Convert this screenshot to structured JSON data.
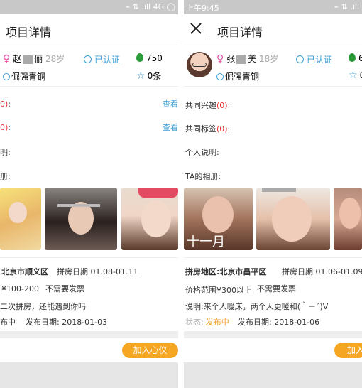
{
  "left": {
    "status": {
      "time": "",
      "indicators": "⌁ ⇅ .ıll 4G ◯"
    },
    "title": "项目详情",
    "name": "赵",
    "name2": "俪",
    "age": "28岁",
    "verified": "已认证",
    "points": "750",
    "medal": "倔强青铜",
    "stars": "0条",
    "rows": [
      {
        "label": "0)",
        "suffix": ":",
        "link": "查看"
      },
      {
        "label": "0)",
        "suffix": ":",
        "link": "查看"
      },
      {
        "label": "明:",
        "suffix": "",
        "link": ""
      },
      {
        "label": "册:",
        "suffix": "",
        "link": ""
      }
    ],
    "trip": {
      "area": "北京市顺义区",
      "date_label": "拼房日期",
      "date": "01.08-01.11",
      "price": "¥100-200",
      "invoice": "不需要发票",
      "desc": "二次拼房，还能遇到你吗",
      "state": "布中",
      "publish_label": "发布日期:",
      "publish": "2018-01-03"
    },
    "join": "加入心仪"
  },
  "right": {
    "status": {
      "time": "上午9:45",
      "indicators": "⌁ ⇅ .ıll"
    },
    "title": "项目详情",
    "name": "张",
    "name2": "美",
    "age": "18岁",
    "verified": "已认证",
    "points": "6",
    "medal": "倔强青铜",
    "stars": "0",
    "rows": [
      {
        "label": "共同兴趣",
        "count": "(0)",
        "suffix": ":"
      },
      {
        "label": "共同标签",
        "count": "(0)",
        "suffix": ":"
      },
      {
        "label": "个人说明:",
        "count": "",
        "suffix": ""
      },
      {
        "label": "TA的相册:",
        "count": "",
        "suffix": ""
      }
    ],
    "photo_overlay": "十一月",
    "trip": {
      "area_label": "拼房地区:",
      "area": "北京市昌平区",
      "date_label": "拼房日期",
      "date": "01.06-01.09",
      "price_label": "价格范围",
      "price": "¥300以上",
      "invoice": "不需要发票",
      "desc_label": "说明:",
      "desc": "来个人暖床，两个人更暖和(｀－´)V",
      "state_label": "状态:",
      "state": "发布中",
      "publish_label": "发布日期:",
      "publish": "2018-01-06"
    },
    "join": "加入"
  }
}
